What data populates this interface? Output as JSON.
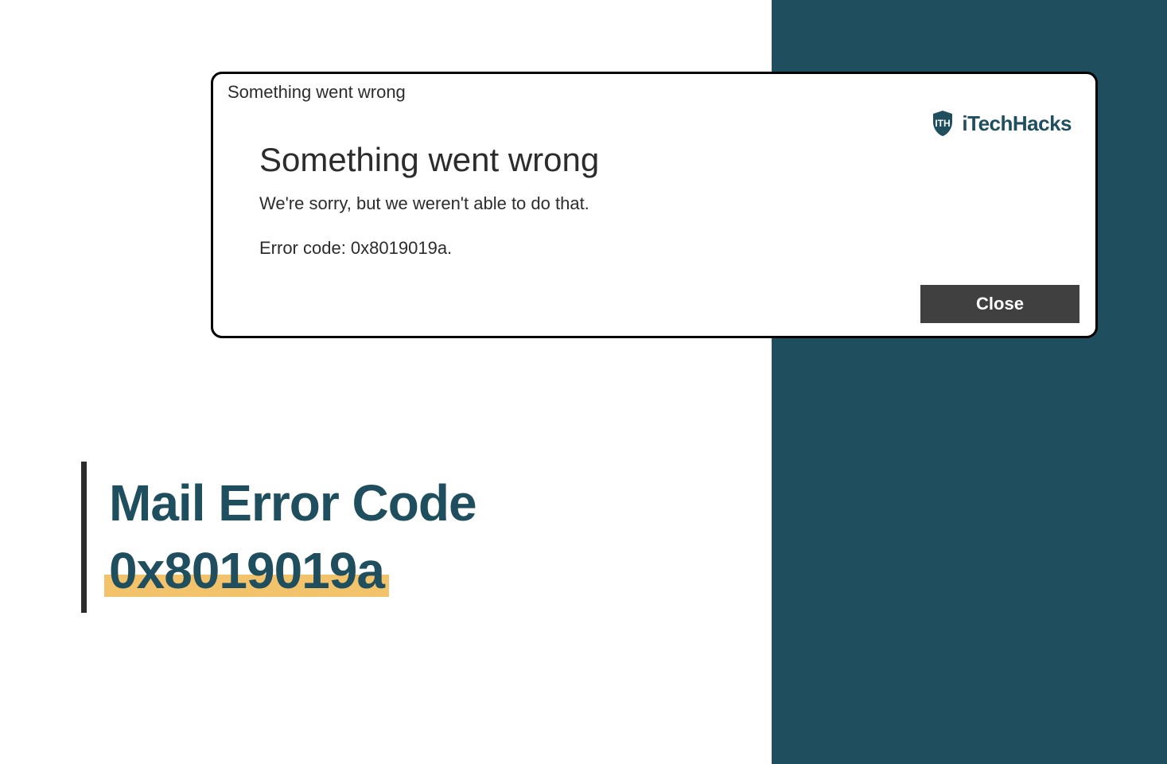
{
  "dialog": {
    "title_small": "Something went wrong",
    "heading": "Something went wrong",
    "message": "We're sorry, but we weren't able to do that.",
    "error_code": "Error code: 0x8019019a.",
    "close_label": "Close"
  },
  "brand": {
    "name": "iTechHacks"
  },
  "article": {
    "title_line1": "Mail Error Code",
    "title_line2": "0x8019019a"
  },
  "colors": {
    "teal": "#1f4e5f",
    "highlight": "#f2c36b",
    "button_bg": "#404040"
  }
}
